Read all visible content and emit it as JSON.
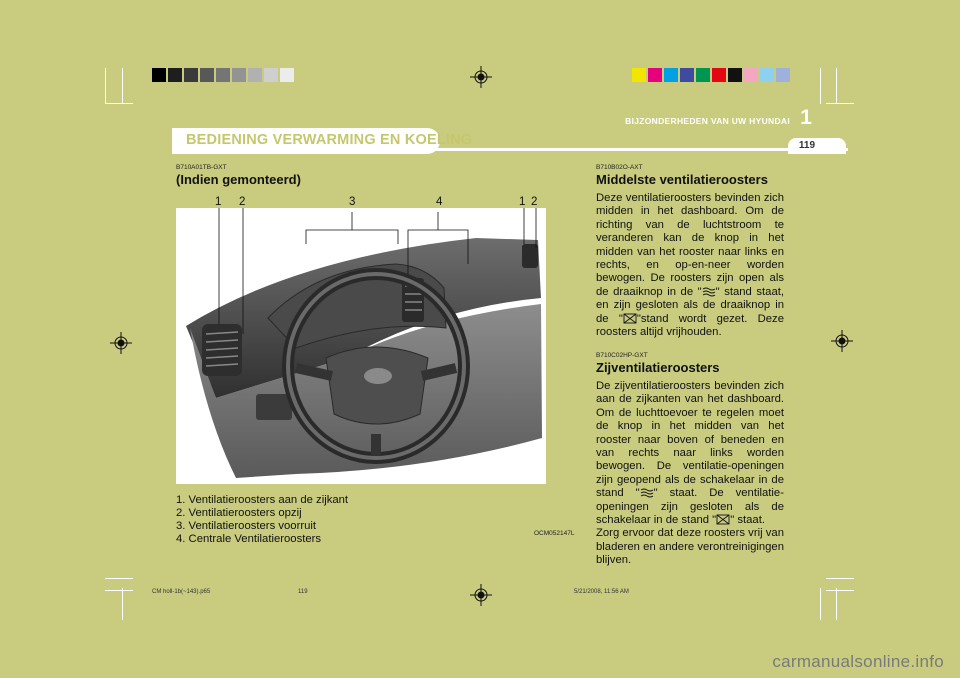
{
  "header": {
    "section_title": "BEDIENING VERWARMING EN KOELING",
    "chapter_label": "BIJZONDERHEDEN VAN UW HYUNDAI",
    "chapter_number": "1",
    "page_number": "119"
  },
  "colors": {
    "page_background": "#c9cc7f",
    "header_text": "#c6c76c",
    "grayscale_swatches": [
      "#000000",
      "#1e1e1e",
      "#3a3a3a",
      "#585858",
      "#757575",
      "#939393",
      "#b1b1b1",
      "#cfcfcf",
      "#ececec"
    ],
    "color_swatches": [
      "#f2e600",
      "#e6007e",
      "#00a0e3",
      "#3e4b9f",
      "#00964f",
      "#e30613",
      "#111111",
      "#f4a7c3",
      "#8fd0f0",
      "#9db1dc"
    ]
  },
  "left": {
    "code": "B710A01TB-GXT",
    "title": "(Indien gemonteerd)",
    "callouts": [
      "1",
      "2",
      "3",
      "4",
      "1",
      "2"
    ],
    "legend": [
      "1. Ventilatieroosters aan de zijkant",
      "2. Ventilatieroosters opzij",
      "3. Ventilatieroosters voorruit",
      "4. Centrale Ventilatieroosters"
    ],
    "image_code": "OCM052147L"
  },
  "right": {
    "sec1": {
      "code": "B710B02O-AXT",
      "title": "Middelste ventilatieroosters",
      "p1": "Deze ventilatieroosters bevinden zich midden in het dashboard. Om de richting van de luchtstroom te veranderen kan de knop in het midden van het rooster naar links en rechts, en op-en-neer worden bewogen. De roosters zijn open als de draaiknop in de \"",
      "p2": "\" stand staat, en zijn gesloten als de draaiknop in de \"",
      "p3": "\"stand wordt gezet. Deze roosters altijd vrijhouden."
    },
    "sec2": {
      "code": "B710C02HP-GXT",
      "title": "Zijventilatieroosters",
      "p1": "De zijventilatieroosters bevinden zich aan de zijkanten van het dashboard. Om de luchttoevoer te regelen moet de knop in het midden van het rooster naar boven of beneden en van rechts naar links worden bewogen. De ventilatie-openingen zijn geopend als de schakelaar in de stand \"",
      "p2": "\" staat. De ventilatie-openingen zijn gesloten als de schakelaar in de stand \"",
      "p3": "\" staat.",
      "p4": "Zorg ervoor dat deze roosters vrij van bladeren en andere verontreinigingen blijven."
    }
  },
  "footer": {
    "file": "CM holl-1b(~143).p65",
    "page": "119",
    "datetime": "5/21/2008, 11:56 AM"
  },
  "watermark": "carmanualsonline.info",
  "icons": {
    "open": "airflow-open-icon",
    "closed": "airflow-closed-icon",
    "registration": "registration-mark-icon"
  }
}
